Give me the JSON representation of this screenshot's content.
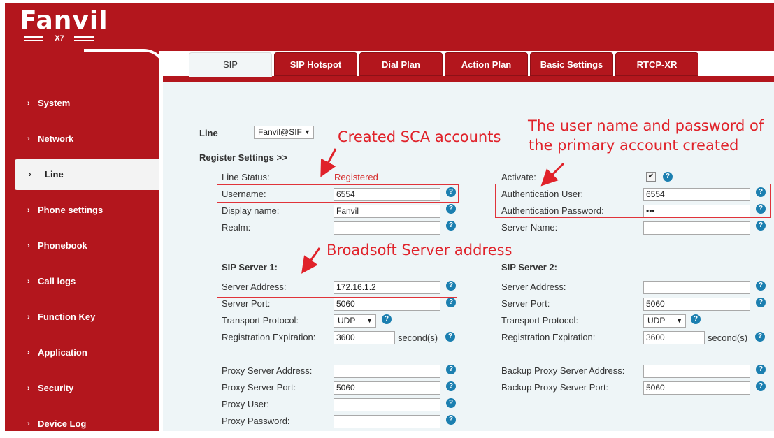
{
  "brand": {
    "logo_text": "Fanvil",
    "model": "X7"
  },
  "sidebar": {
    "items": [
      {
        "label": "System"
      },
      {
        "label": "Network"
      },
      {
        "label": "Line"
      },
      {
        "label": "Phone settings"
      },
      {
        "label": "Phonebook"
      },
      {
        "label": "Call logs"
      },
      {
        "label": "Function Key"
      },
      {
        "label": "Application"
      },
      {
        "label": "Security"
      },
      {
        "label": "Device Log"
      }
    ],
    "active": "Line",
    "chevron": "›"
  },
  "tabs": [
    {
      "label": "SIP",
      "active": true
    },
    {
      "label": "SIP Hotspot"
    },
    {
      "label": "Dial Plan"
    },
    {
      "label": "Action Plan"
    },
    {
      "label": "Basic Settings"
    },
    {
      "label": "RTCP-XR"
    }
  ],
  "line_select": {
    "label": "Line",
    "value": "Fanvil@SIF"
  },
  "register_settings": {
    "heading": "Register Settings >>",
    "line_status_label": "Line Status:",
    "line_status_value": "Registered",
    "username_label": "Username:",
    "username_value": "6554",
    "display_name_label": "Display name:",
    "display_name_value": "Fanvil",
    "realm_label": "Realm:",
    "realm_value": "",
    "activate_label": "Activate:",
    "activate_checked": true,
    "auth_user_label": "Authentication User:",
    "auth_user_value": "6554",
    "auth_password_label": "Authentication Password:",
    "auth_password_value": "•••",
    "server_name_label": "Server Name:",
    "server_name_value": ""
  },
  "sip_server_1": {
    "heading": "SIP Server 1:",
    "server_address_label": "Server Address:",
    "server_address_value": "172.16.1.2",
    "server_port_label": "Server Port:",
    "server_port_value": "5060",
    "transport_label": "Transport Protocol:",
    "transport_value": "UDP",
    "reg_exp_label": "Registration Expiration:",
    "reg_exp_value": "3600",
    "reg_exp_unit": "second(s)"
  },
  "sip_server_2": {
    "heading": "SIP Server 2:",
    "server_address_label": "Server Address:",
    "server_address_value": "",
    "server_port_label": "Server Port:",
    "server_port_value": "5060",
    "transport_label": "Transport Protocol:",
    "transport_value": "UDP",
    "reg_exp_label": "Registration Expiration:",
    "reg_exp_value": "3600",
    "reg_exp_unit": "second(s)"
  },
  "proxy": {
    "proxy_address_label": "Proxy Server Address:",
    "proxy_address_value": "",
    "proxy_port_label": "Proxy Server Port:",
    "proxy_port_value": "5060",
    "proxy_user_label": "Proxy User:",
    "proxy_user_value": "",
    "proxy_password_label": "Proxy Password:",
    "proxy_password_value": "",
    "backup_address_label": "Backup Proxy Server Address:",
    "backup_address_value": "",
    "backup_port_label": "Backup Proxy Server Port:",
    "backup_port_value": "5060"
  },
  "annotations": {
    "sca": "Created SCA accounts",
    "primary_line1": "The user name and password of",
    "primary_line2": "the primary account created",
    "broadsoft": "Broadsoft Server address"
  },
  "help_glyph": "?",
  "select_arrow": "▼",
  "check_glyph": "✔",
  "colors": {
    "brand_red": "#b3161d",
    "annotation_red": "#e0222a",
    "help_blue": "#1b7fb0",
    "content_bg": "#eef5f7"
  }
}
